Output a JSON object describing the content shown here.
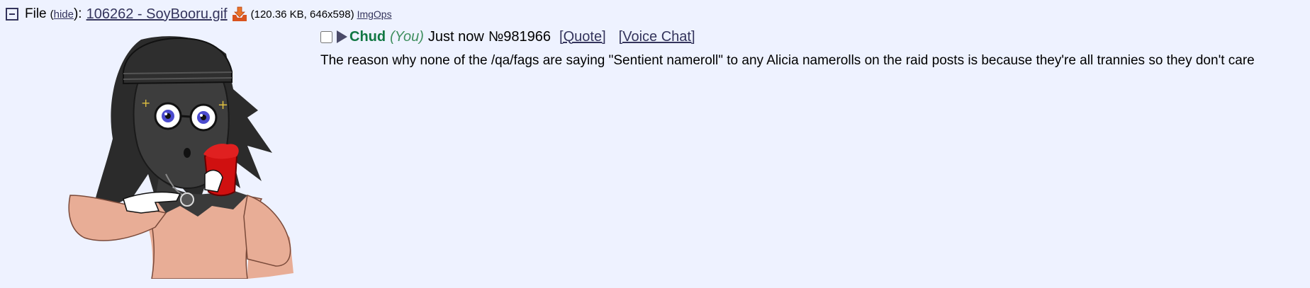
{
  "file": {
    "label": "File",
    "hide_open": " (",
    "hide_label": "hide",
    "hide_close": "):",
    "filename": "106262 - SoyBooru.gif",
    "meta": "(120.36 KB, 646x598)",
    "imgops_label": "ImgOps",
    "collapse_icon": "collapse-minus-icon",
    "download_icon": "download-icon"
  },
  "post": {
    "name": "Chud",
    "you_label": "(You)",
    "time": "Just now",
    "number": "№981966",
    "quote_label": "[Quote]",
    "voice_chat_label": "[Voice Chat]",
    "body": "The reason why none of the /qa/fags are saying \"Sentient nameroll\" to any Alicia namerolls on the raid posts is because they're all trannies so they don't care"
  },
  "colors": {
    "background": "#eef2ff",
    "link": "#34345c",
    "name": "#117743",
    "you": "#3f8f5f"
  }
}
